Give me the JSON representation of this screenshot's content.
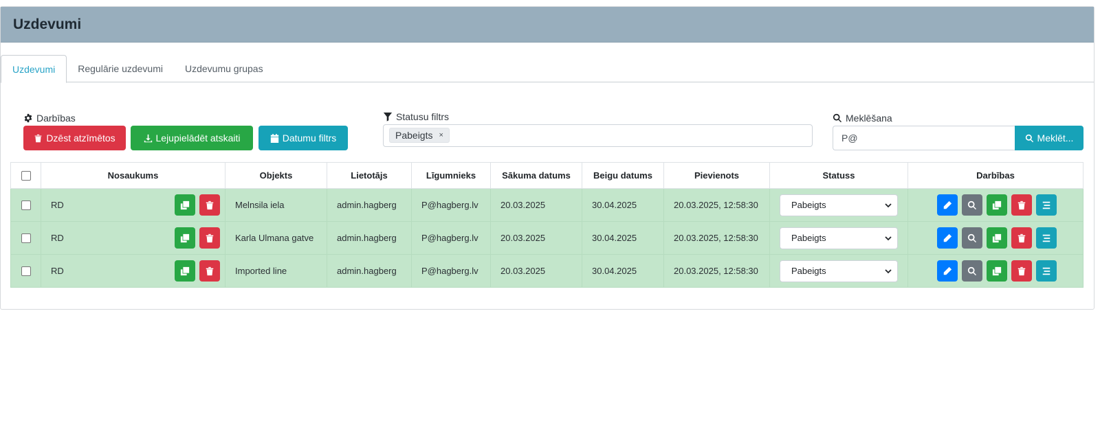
{
  "page_title": "Uzdevumi",
  "tabs": [
    {
      "label": "Uzdevumi",
      "active": true
    },
    {
      "label": "Regulārie uzdevumi",
      "active": false
    },
    {
      "label": "Uzdevumu grupas",
      "active": false
    }
  ],
  "actions": {
    "label": "Darbības",
    "delete_selected": "Dzēst atzīmētos",
    "download_report": "Lejupielādēt atskaiti",
    "date_filter": "Datumu filtrs"
  },
  "status_filter": {
    "label": "Statusu filtrs",
    "chips": [
      "Pabeigts"
    ],
    "chip_remove": "×"
  },
  "search": {
    "label": "Meklēšana",
    "value": "P@",
    "button": "Meklēt..."
  },
  "table": {
    "headers": {
      "name": "Nosaukums",
      "object": "Objekts",
      "user": "Lietotājs",
      "contractor": "Līgumnieks",
      "start": "Sākuma datums",
      "end": "Beigu datums",
      "added": "Pievienots",
      "status": "Statuss",
      "actions": "Darbības"
    },
    "rows": [
      {
        "name": "RD",
        "object": "Melnsila iela",
        "user": "admin.hagberg",
        "contractor": "P@hagberg.lv",
        "start": "20.03.2025",
        "end": "30.04.2025",
        "added": "20.03.2025, 12:58:30",
        "status": "Pabeigts"
      },
      {
        "name": "RD",
        "object": "Karla Ulmana gatve",
        "user": "admin.hagberg",
        "contractor": "P@hagberg.lv",
        "start": "20.03.2025",
        "end": "30.04.2025",
        "added": "20.03.2025, 12:58:30",
        "status": "Pabeigts"
      },
      {
        "name": "RD",
        "object": "Imported line",
        "user": "admin.hagberg",
        "contractor": "P@hagberg.lv",
        "start": "20.03.2025",
        "end": "30.04.2025",
        "added": "20.03.2025, 12:58:30",
        "status": "Pabeigts"
      }
    ]
  },
  "colors": {
    "header_bg": "#98aebd",
    "row_bg": "#c3e6cb",
    "danger": "#dc3545",
    "success": "#28a745",
    "info": "#17a2b8",
    "primary": "#007bff",
    "secondary": "#6c757d"
  },
  "icons": [
    "gear-icon",
    "filter-icon",
    "search-icon",
    "trash-icon",
    "download-icon",
    "calendar-icon",
    "copy-icon",
    "pencil-icon",
    "list-icon",
    "chevron-down-icon"
  ]
}
